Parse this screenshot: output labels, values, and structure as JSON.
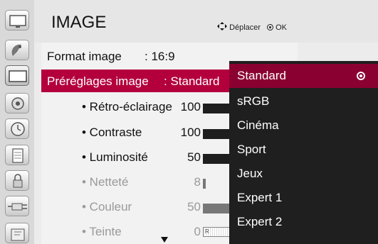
{
  "header": {
    "title": "IMAGE",
    "help_move": "Déplacer",
    "help_ok": "OK"
  },
  "menu": {
    "format": {
      "label": "Format image",
      "value": ": 16:9"
    },
    "presets": {
      "label": "Préréglages image",
      "value": ": Standard"
    }
  },
  "settings": [
    {
      "name": "• Rétro-éclairage",
      "value": "100",
      "level": 1.0
    },
    {
      "name": "• Contraste",
      "value": "100",
      "level": 1.0
    },
    {
      "name": "• Luminosité",
      "value": "50",
      "level": 0.5
    },
    {
      "name": "• Netteté",
      "value": "8",
      "level": 0.08
    },
    {
      "name": "• Couleur",
      "value": "50",
      "level": 0.5
    },
    {
      "name": "• Teinte",
      "value": "0",
      "bar_text": "R"
    }
  ],
  "dropdown": {
    "items": [
      "Standard",
      "sRGB",
      "Cinéma",
      "Sport",
      "Jeux",
      "Expert 1",
      "Expert 2"
    ],
    "selected": "Standard"
  },
  "sidebar_icons": [
    "tv-icon",
    "satellite-icon",
    "picture-icon",
    "speaker-icon",
    "clock-icon",
    "settings-list-icon",
    "lock-icon",
    "input-plug-icon",
    "usb-icon"
  ]
}
